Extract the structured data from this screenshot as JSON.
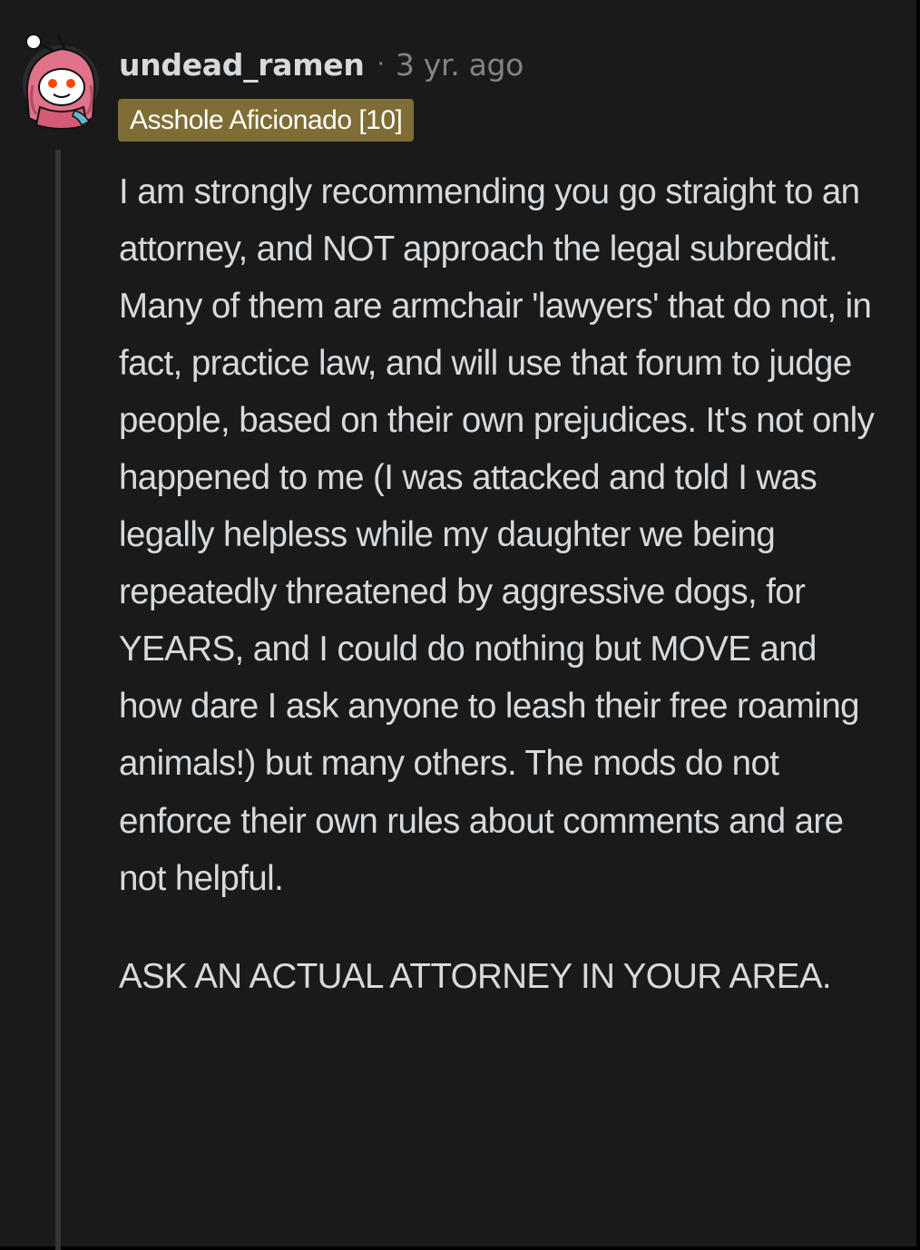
{
  "comment": {
    "author": "undead_ramen",
    "separator": "·",
    "age": "3 yr. ago",
    "flair": "Asshole Aficionado [10]",
    "paragraphs": [
      "I am strongly recommending you go straight to an attorney, and NOT approach the legal subreddit. Many of them are armchair 'lawyers' that do not, in fact, practice law, and will use that forum to judge people, based on their own prejudices. It's not only happened to me (I was attacked and told I was legally helpless while my daughter we being repeatedly threatened by aggressive dogs, for YEARS, and I could do nothing but MOVE and how dare I ask anyone to leash their free roaming animals!) but many others. The mods do not enforce their own rules about comments and are not helpful.",
      "ASK AN ACTUAL ATTORNEY IN YOUR AREA."
    ],
    "avatar_icon": "snoo-avatar-icon"
  },
  "colors": {
    "background": "#1a1a1b",
    "text": "#d7dadc",
    "muted": "#818384",
    "flair_bg": "#7e6e35",
    "thread_line": "#343536"
  }
}
